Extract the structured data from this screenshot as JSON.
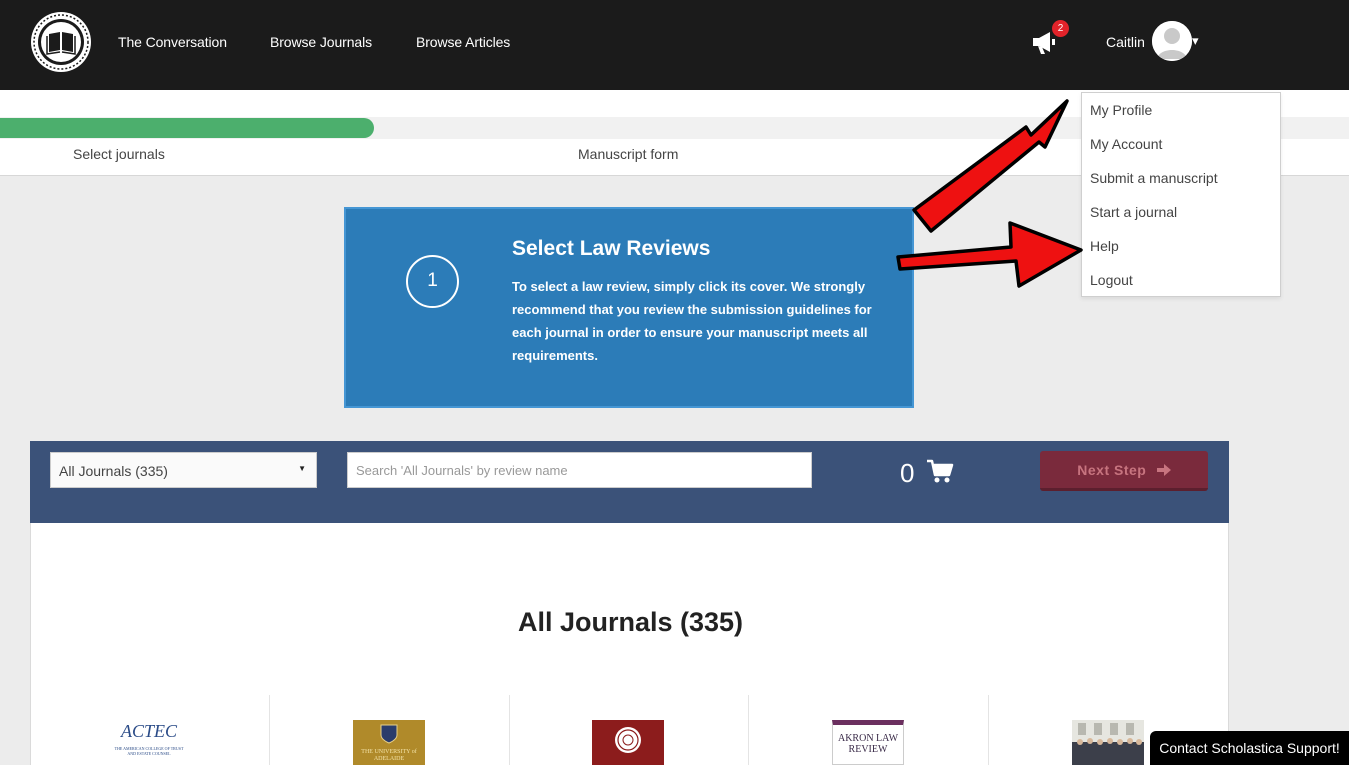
{
  "nav": {
    "links": [
      "The Conversation",
      "Browse Journals",
      "Browse Articles"
    ],
    "notification_count": "2",
    "user_name": "Caitlin",
    "caret": "▾"
  },
  "progress": {
    "percent": 27.7,
    "steps": [
      "Select journals",
      "Manuscript form"
    ]
  },
  "info_box": {
    "step_number": "1",
    "title": "Select Law Reviews",
    "text": "To select a law review, simply click its cover. We strongly recommend that you review the submission guidelines for each journal in order to ensure your manuscript meets all requirements."
  },
  "dropdown": {
    "items": [
      "My Profile",
      "My Account",
      "Submit a manuscript",
      "Start a journal",
      "Help",
      "Logout"
    ]
  },
  "filter": {
    "selected_option": "All Journals (335)",
    "search_placeholder": "Search 'All Journals' by review name",
    "cart_count": "0",
    "next_label": "Next Step"
  },
  "journals": {
    "title": "All Journals (335)",
    "covers": [
      {
        "name": "actec-cover",
        "logo_text": "ACTEC",
        "sub_text": "THE AMERICAN COLLEGE OF TRUST AND ESTATE COUNSEL"
      },
      {
        "name": "adelaide-cover",
        "logo_text": "THE UNIVERSITY of ADELAIDE"
      },
      {
        "name": "journal-cover-3"
      },
      {
        "name": "akron-cover",
        "logo_text": "AKRON LAW REVIEW"
      },
      {
        "name": "journal-cover-5"
      }
    ]
  },
  "support_label": "Contact Scholastica Support!",
  "colors": {
    "nav_bg": "#1b1b1b",
    "progress_green": "#4caf6d",
    "info_blue": "#2c7cb8",
    "filter_bar": "#3b5279",
    "next_button": "#7a2a3c",
    "badge_red": "#e2232a",
    "arrow_red": "#ee1111"
  }
}
